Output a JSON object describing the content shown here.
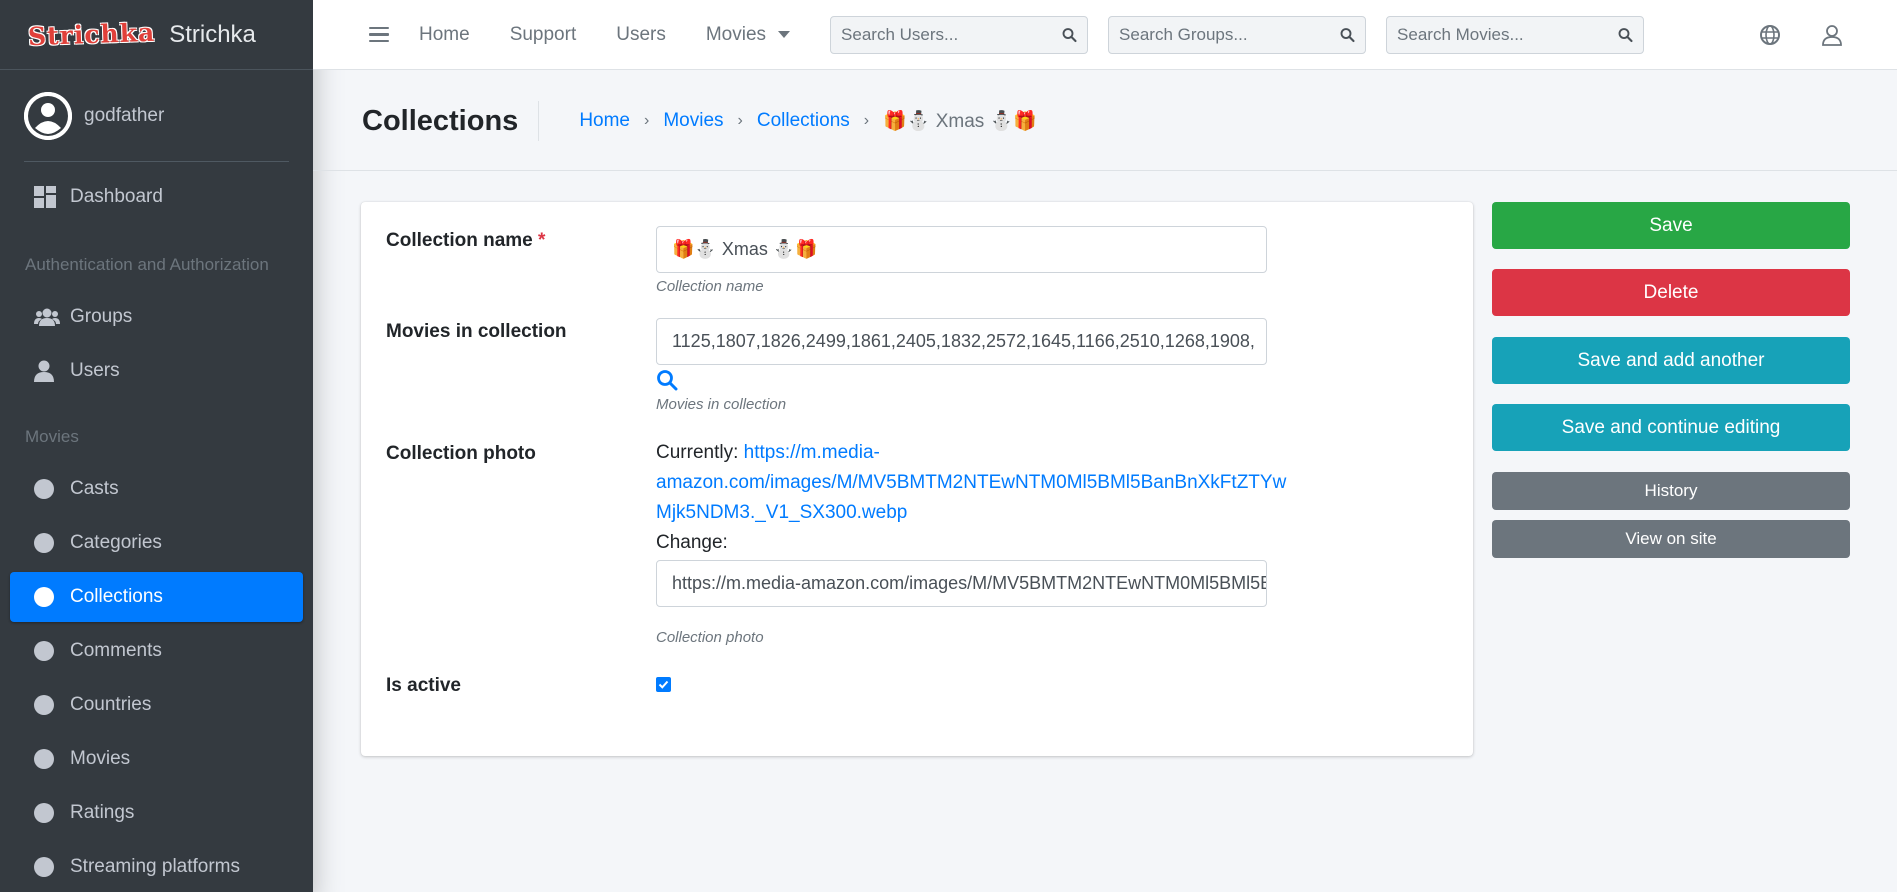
{
  "brand": {
    "logo_text": "Strichka",
    "name": "Strichka"
  },
  "user": {
    "name": "godfather"
  },
  "sidebar": {
    "dashboard": "Dashboard",
    "auth_header": "Authentication and Authorization",
    "groups": "Groups",
    "users": "Users",
    "movies_header": "Movies",
    "items": [
      "Casts",
      "Categories",
      "Collections",
      "Comments",
      "Countries",
      "Movies",
      "Ratings",
      "Streaming platforms"
    ],
    "active_item": "Collections"
  },
  "topnav": {
    "home": "Home",
    "support": "Support",
    "users": "Users",
    "movies": "Movies",
    "search_users_placeholder": "Search Users...",
    "search_groups_placeholder": "Search Groups...",
    "search_movies_placeholder": "Search Movies..."
  },
  "header": {
    "title": "Collections",
    "breadcrumb": [
      "Home",
      "Movies",
      "Collections"
    ],
    "breadcrumb_current": "🎁⛄ Xmas ⛄🎁"
  },
  "form": {
    "name_label": "Collection name",
    "required_mark": "*",
    "name_value": "🎁⛄ Xmas ⛄🎁",
    "name_help": "Collection name",
    "movies_label": "Movies in collection",
    "movies_value": "1125,1807,1826,2499,1861,2405,1832,2572,1645,1166,2510,1268,1908,",
    "movies_help": "Movies in collection",
    "photo_label": "Collection photo",
    "currently_label": "Currently:",
    "photo_url_line1": "https://m.media-",
    "photo_url_line2": "amazon.com/images/M/MV5BMTM2NTEwNTM0Ml5BMl5BanBnXkFtZTYw",
    "photo_url_line3": "Mjk5NDM3._V1_SX300.webp",
    "change_label": "Change:",
    "photo_value": "https://m.media-amazon.com/images/M/MV5BMTM2NTEwNTM0Ml5BMl5BanBnXkFtZTYwMjk5NDM3._V1_SX300.webp",
    "photo_help": "Collection photo",
    "active_label": "Is active",
    "is_active": true
  },
  "actions": {
    "save": "Save",
    "delete": "Delete",
    "save_add": "Save and add another",
    "save_continue": "Save and continue editing",
    "history": "History",
    "view_site": "View on site"
  },
  "colors": {
    "primary": "#007bff",
    "success": "#28a745",
    "danger": "#dc3545",
    "info": "#17a2b8",
    "secondary": "#6c757d",
    "sidebar": "#343a40"
  }
}
